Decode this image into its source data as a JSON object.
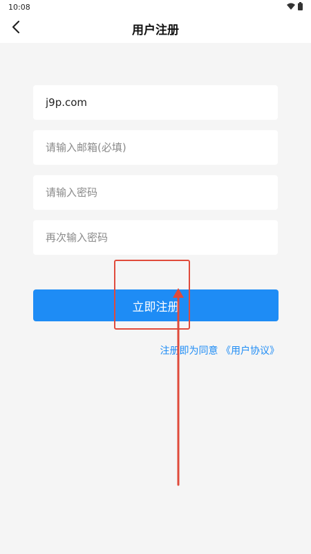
{
  "status_bar": {
    "time": "10:08",
    "icons": [
      "wifi-icon",
      "battery-icon"
    ]
  },
  "header": {
    "title": "用户注册",
    "back_icon": "chevron-left-icon"
  },
  "form": {
    "username": {
      "value": "j9p.com",
      "placeholder": ""
    },
    "email": {
      "value": "",
      "placeholder": "请输入邮箱(必填)"
    },
    "password": {
      "value": "",
      "placeholder": "请输入密码"
    },
    "confirm_password": {
      "value": "",
      "placeholder": "再次输入密码"
    },
    "submit_label": "立即注册"
  },
  "agreement": {
    "prefix": "注册即为同意 ",
    "link": "《用户协议》"
  },
  "colors": {
    "accent": "#1e8cf5",
    "annotation": "#e04a3a",
    "background": "#f5f5f5"
  }
}
